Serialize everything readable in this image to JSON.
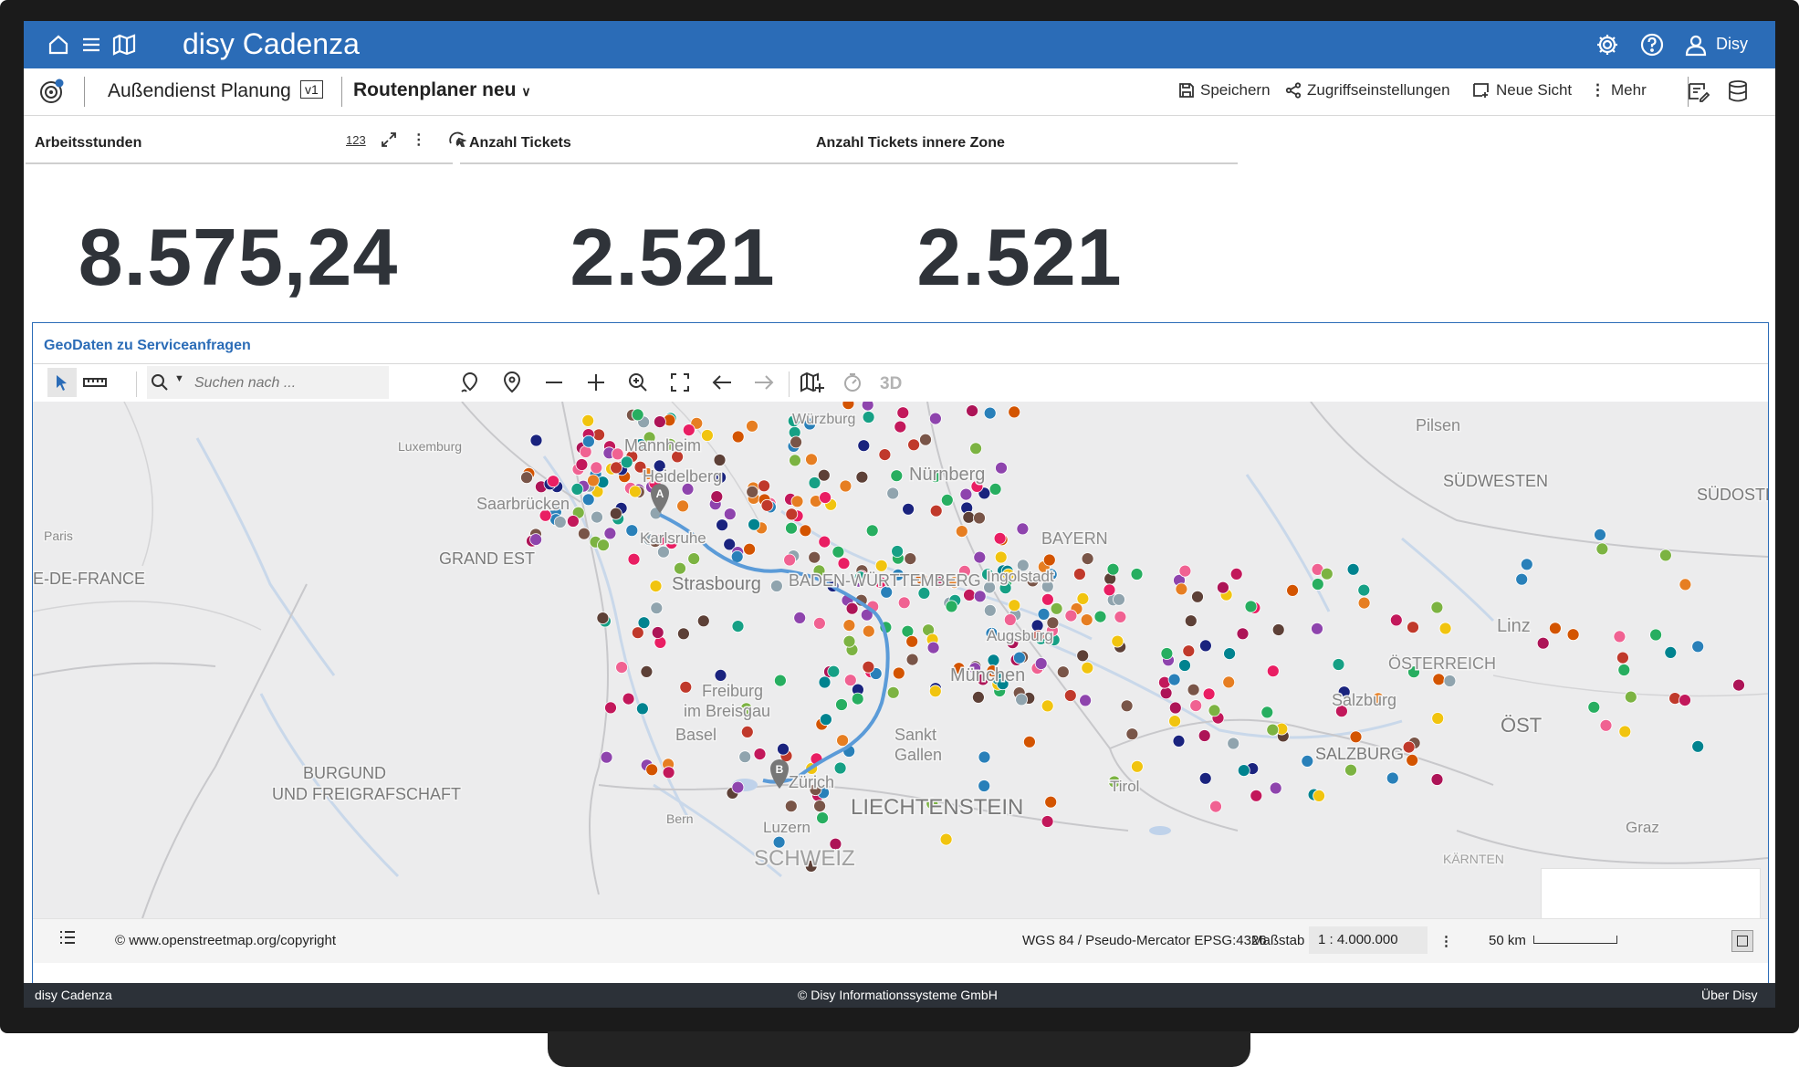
{
  "app": {
    "brand": "disy Cadenza",
    "user": "Disy"
  },
  "toolbar": {
    "workbook": "Außendienst Planung",
    "version": "v1",
    "view": "Routenplaner neu",
    "save": "Speichern",
    "access": "Zugriffseinstellungen",
    "new_view": "Neue Sicht",
    "more": "Mehr"
  },
  "kpis": [
    {
      "title": "Arbeitsstunden",
      "value": "8.575,24"
    },
    {
      "title": "Anzahl Tickets",
      "value": "2.521"
    },
    {
      "title": "Anzahl Tickets innere Zone",
      "value": "2.521"
    }
  ],
  "map": {
    "title": "GeoDaten zu Serviceanfragen",
    "search_placeholder": "Suchen nach ...",
    "three_d": "3D",
    "copyright": "© www.openstreetmap.org/copyright",
    "crs": "WGS 84 / Pseudo-Mercator EPSG:4326",
    "scale_label": "Maßstab",
    "scale_value": "1 : 4.000.000",
    "scalebar": "50 km",
    "route_markers": [
      "A",
      "B"
    ],
    "places": [
      "Würzburg",
      "Luxemburg",
      "Mannheim",
      "Heidelberg",
      "Nürnberg",
      "SÜDWESTEN",
      "SÜDOSTE",
      "Saarbrücken",
      "Paris",
      "GRAND EST",
      "E-DE-FRANCE",
      "Karlsruhe",
      "BAYERN",
      "Strasbourg",
      "BADEN-WÜRTTEMBERG",
      "Ingolstadt",
      "Augsburg",
      "Linz",
      "München",
      "ÖSTERREICH",
      "Freiburg",
      "im Breisgau",
      "Salzburg",
      "ÖST",
      "Basel",
      "Sankt",
      "Gallen",
      "SALZBURG",
      "BURGUND",
      "UND FREIGRAFSCHAFT",
      "Zürich",
      "LIECHTENSTEIN",
      "Tirol",
      "Bern",
      "Luzern",
      "SCHWEIZ",
      "Graz",
      "KÄRNTEN",
      "Pilsen"
    ]
  },
  "footer": {
    "left": "disy Cadenza",
    "center": "© Disy Informationssysteme GmbH",
    "right": "Über Disy"
  },
  "colors": {
    "accent": "#2b6cb7",
    "route": "#5b9bd8",
    "footer": "#2c3138"
  }
}
